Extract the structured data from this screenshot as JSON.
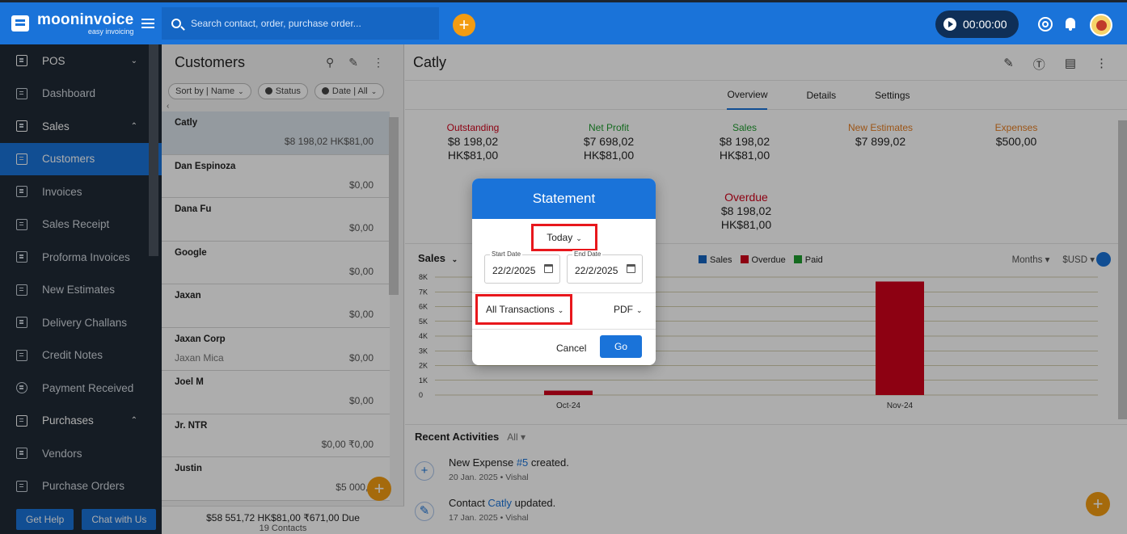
{
  "header": {
    "app_name": "mooninvoice",
    "tagline": "easy invoicing",
    "search_placeholder": "Search contact, order, purchase order...",
    "add_symbol": "+",
    "timer": "00:00:00"
  },
  "sidebar": {
    "items": [
      {
        "label": "POS",
        "icon": "shop-icon",
        "type": "section"
      },
      {
        "label": "Dashboard",
        "icon": "home-icon",
        "type": "item"
      },
      {
        "label": "Sales",
        "icon": "dollar-icon",
        "type": "section"
      },
      {
        "label": "Customers",
        "icon": "contacts-icon",
        "type": "active"
      },
      {
        "label": "Invoices",
        "icon": "invoice-icon",
        "type": "item"
      },
      {
        "label": "Sales Receipt",
        "icon": "receipt-icon",
        "type": "item"
      },
      {
        "label": "Proforma Invoices",
        "icon": "document-icon",
        "type": "item"
      },
      {
        "label": "New Estimates",
        "icon": "estimate-icon",
        "type": "item"
      },
      {
        "label": "Delivery Challans",
        "icon": "delivery-icon",
        "type": "item"
      },
      {
        "label": "Credit Notes",
        "icon": "credit-note-icon",
        "type": "item"
      },
      {
        "label": "Payment Received",
        "icon": "payment-icon",
        "type": "item"
      },
      {
        "label": "Purchases",
        "icon": "purchases-icon",
        "type": "section"
      },
      {
        "label": "Vendors",
        "icon": "vendors-icon",
        "type": "item"
      },
      {
        "label": "Purchase Orders",
        "icon": "cart-icon",
        "type": "item"
      }
    ],
    "get_help": "Get Help",
    "chat": "Chat with Us"
  },
  "customers": {
    "title": "Customers",
    "filters": {
      "sort": "Sort by | Name",
      "status": "Status",
      "date": "Date | All"
    },
    "list": [
      {
        "name": "Catly",
        "sub": "",
        "amount": "$8 198,02 HK$81,00"
      },
      {
        "name": "Dan Espinoza",
        "sub": "",
        "amount": "$0,00"
      },
      {
        "name": "Dana Fu",
        "sub": "",
        "amount": "$0,00"
      },
      {
        "name": "Google",
        "sub": "",
        "amount": "$0,00"
      },
      {
        "name": "Jaxan",
        "sub": "",
        "amount": "$0,00"
      },
      {
        "name": "Jaxan Corp",
        "sub": "Jaxan Mica",
        "amount": "$0,00"
      },
      {
        "name": "Joel M",
        "sub": "",
        "amount": "$0,00"
      },
      {
        "name": "Jr. NTR",
        "sub": "",
        "amount": "$0,00 ₹0,00"
      },
      {
        "name": "Justin",
        "sub": "",
        "amount": "$5 000,0"
      }
    ],
    "footer_total": "$58 551,72 HK$81,00 ₹671,00 Due",
    "footer_count": "19 Contacts"
  },
  "main": {
    "title": "Catly",
    "tabs": [
      "Overview",
      "Details",
      "Settings"
    ],
    "stats": [
      {
        "label": "Outstanding",
        "v1": "$8 198,02",
        "v2": "HK$81,00",
        "color": "red"
      },
      {
        "label": "Net Profit",
        "v1": "$7 698,02",
        "v2": "HK$81,00",
        "color": "green"
      },
      {
        "label": "Sales",
        "v1": "$8 198,02",
        "v2": "HK$81,00",
        "color": "green"
      },
      {
        "label": "New Estimates",
        "v1": "$7 899,02",
        "v2": "",
        "color": "orange"
      },
      {
        "label": "Expenses",
        "v1": "$500,00",
        "v2": "",
        "color": "orange"
      }
    ],
    "overdue": {
      "label": "Overdue",
      "v1": "$8 198,02",
      "v2": "HK$81,00"
    },
    "chart_controls": {
      "period": "Months",
      "currency": "$USD"
    },
    "recent_title": "Recent Activities",
    "recent_filter": "All",
    "activities": [
      {
        "pre": "New Expense ",
        "link": "#5",
        "post": " created.",
        "meta": "20 Jan. 2025 • Vishal",
        "icon": "plus-icon"
      },
      {
        "pre": "Contact ",
        "link": "Catly",
        "post": " updated.",
        "meta": "17 Jan. 2025 • Vishal",
        "icon": "pencil-icon"
      }
    ]
  },
  "chart_data": {
    "type": "bar",
    "title": "Sales",
    "categories": [
      "Oct-24",
      "Nov-24"
    ],
    "series": [
      {
        "name": "Sales",
        "color": "#1565c0",
        "values": [
          0,
          0
        ]
      },
      {
        "name": "Overdue",
        "color": "#d0021b",
        "values": [
          300,
          7700
        ]
      },
      {
        "name": "Paid",
        "color": "#1e9c2e",
        "values": [
          0,
          0
        ]
      }
    ],
    "yticks": [
      "8K",
      "7K",
      "6K",
      "5K",
      "4K",
      "3K",
      "2K",
      "1K",
      "0"
    ],
    "ylim": [
      0,
      8000
    ],
    "grid": true,
    "legend": "top-center"
  },
  "modal": {
    "title": "Statement",
    "period": "Today",
    "start_label": "Start Date",
    "start_value": "22/2/2025",
    "end_label": "End Date",
    "end_value": "22/2/2025",
    "transactions": "All Transactions",
    "format": "PDF",
    "cancel": "Cancel",
    "go": "Go"
  }
}
